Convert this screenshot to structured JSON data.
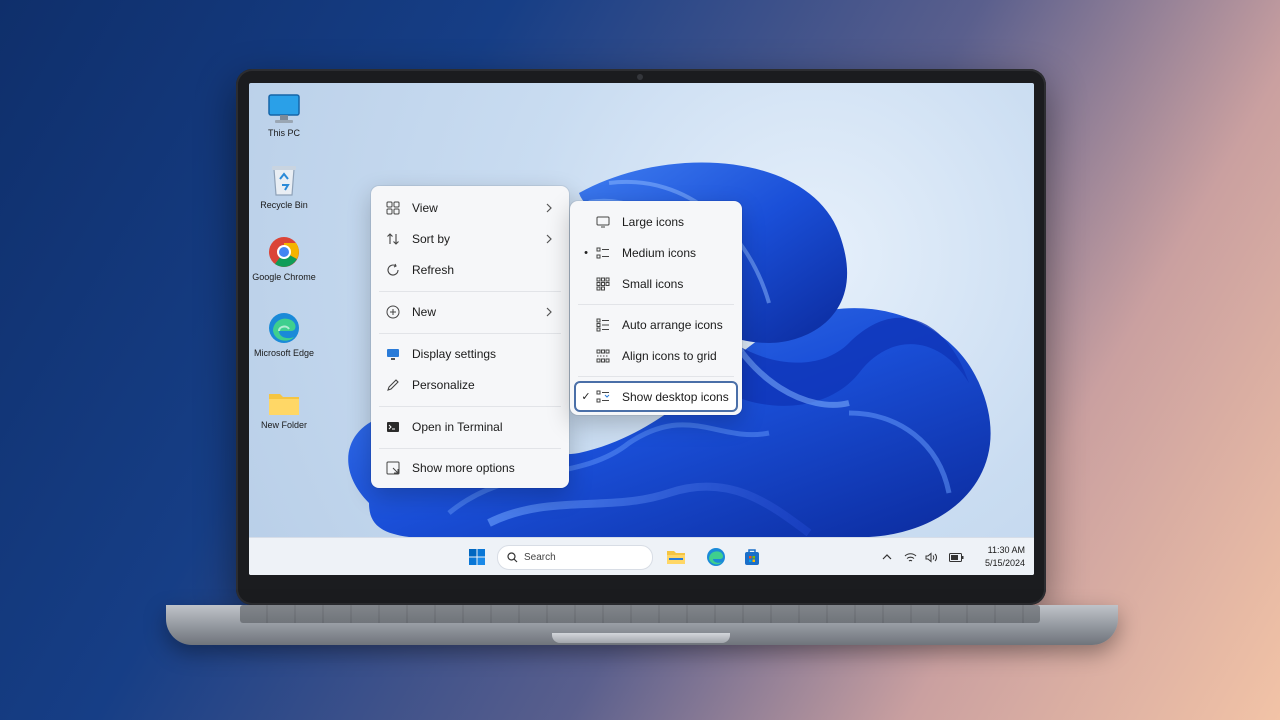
{
  "desktop": {
    "icons": [
      {
        "label": "This PC",
        "icon": "monitor-icon"
      },
      {
        "label": "Recycle Bin",
        "icon": "recycle-bin-icon"
      },
      {
        "label": "Google Chrome",
        "icon": "chrome-icon"
      },
      {
        "label": "Microsoft Edge",
        "icon": "edge-icon"
      },
      {
        "label": "New Folder",
        "icon": "folder-icon"
      }
    ]
  },
  "context_menu": {
    "items": [
      {
        "label": "View",
        "icon": "view-grid-icon",
        "submenu": true
      },
      {
        "label": "Sort by",
        "icon": "sort-icon",
        "submenu": true
      },
      {
        "label": "Refresh",
        "icon": "refresh-icon"
      },
      {
        "label": "New",
        "icon": "new-plus-icon",
        "submenu": true
      },
      {
        "label": "Display settings",
        "icon": "display-settings-icon"
      },
      {
        "label": "Personalize",
        "icon": "personalize-pen-icon"
      },
      {
        "label": "Open in Terminal",
        "icon": "terminal-icon"
      },
      {
        "label": "Show more options",
        "icon": "more-options-icon"
      }
    ]
  },
  "view_submenu": {
    "items": [
      {
        "label": "Large icons",
        "icon": "large-icons-icon"
      },
      {
        "label": "Medium icons",
        "icon": "medium-icons-icon",
        "marker": "•"
      },
      {
        "label": "Small icons",
        "icon": "small-icons-icon"
      },
      {
        "label": "Auto arrange icons",
        "icon": "auto-arrange-icon"
      },
      {
        "label": "Align icons to grid",
        "icon": "align-grid-icon"
      },
      {
        "label": "Show desktop icons",
        "icon": "show-desktop-icon",
        "marker": "✓",
        "highlighted": true
      }
    ]
  },
  "taskbar": {
    "search_placeholder": "Search",
    "time": "11:30 AM",
    "date": "5/15/2024",
    "accent": "#0067c0"
  }
}
